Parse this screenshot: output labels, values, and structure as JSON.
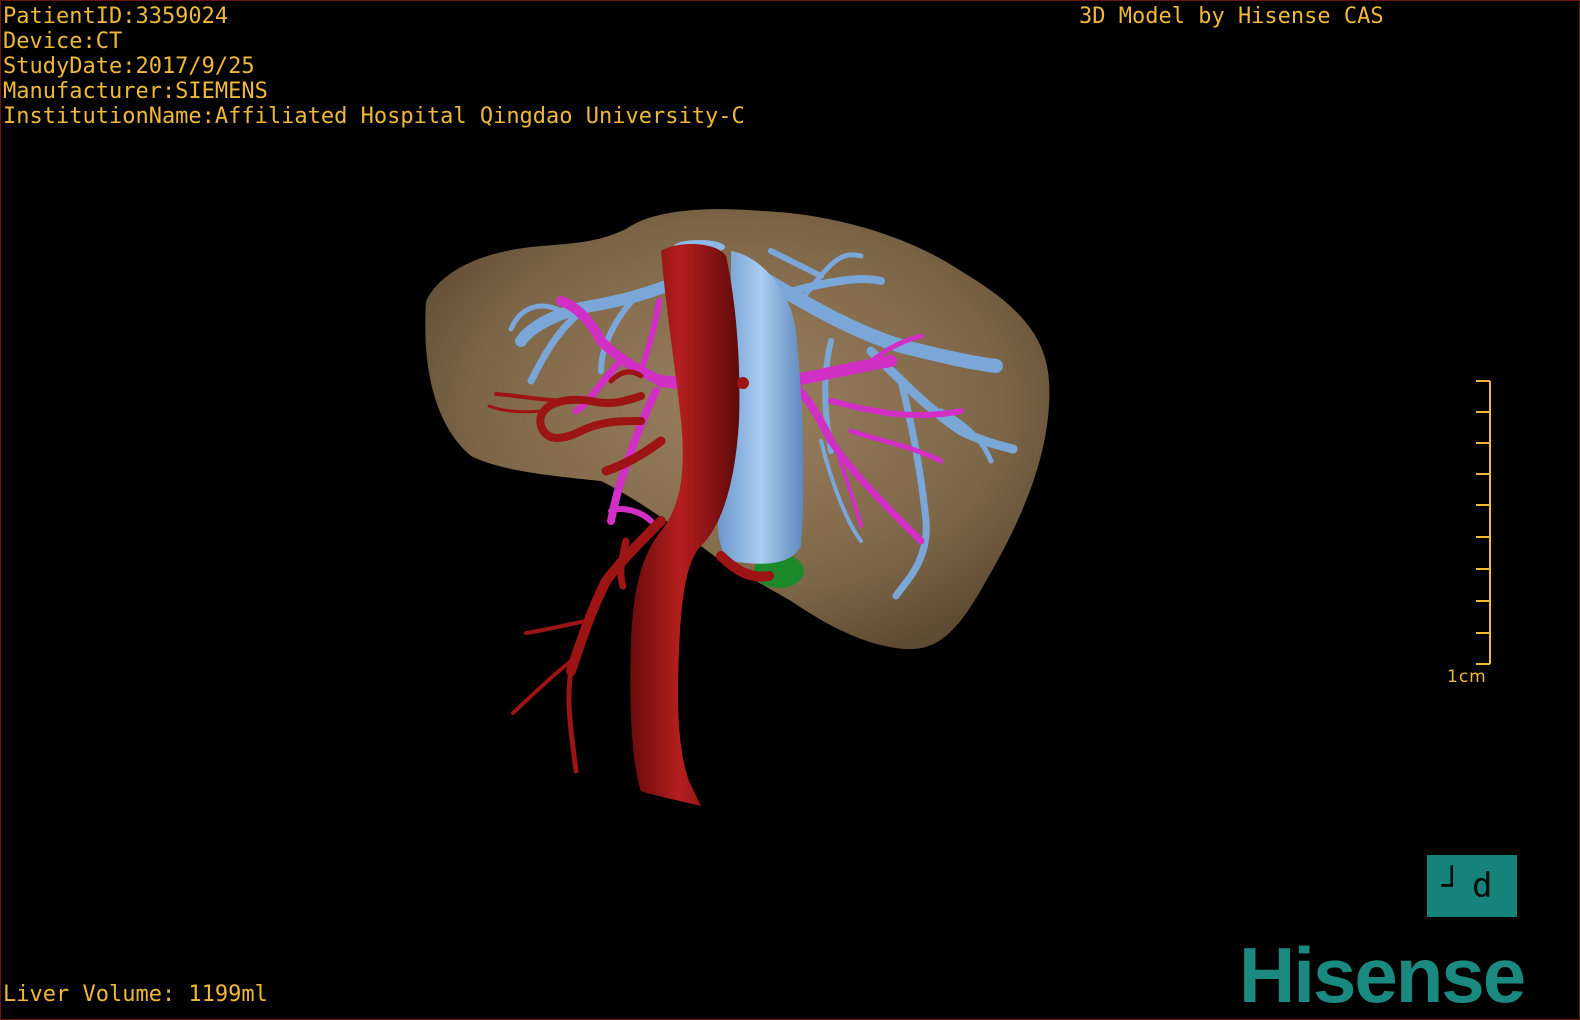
{
  "info": {
    "patient_id": "PatientID:3359024",
    "device": "Device:CT",
    "study_date": "StudyDate:2017/9/25",
    "manufacturer": "Manufacturer:SIEMENS",
    "institution": "InstitutionName:Affiliated Hospital Qingdao University-C"
  },
  "watermark": "3D Model by Hisense CAS",
  "liver_volume": "Liver Volume: 1199ml",
  "scale": {
    "label": "1cm"
  },
  "orientation_button": {
    "label": "┘d"
  },
  "brand": "Hisense",
  "colors": {
    "overlay_text": "#f0b83a",
    "liver": "#8a7150",
    "artery": "#9c1414",
    "portal_vein": "#d12fc6",
    "hepatic_vein": "#7aa6d8",
    "ivc": "#8db8e8",
    "gallbladder": "#1c8a2a",
    "brand": "#1a8a80"
  }
}
